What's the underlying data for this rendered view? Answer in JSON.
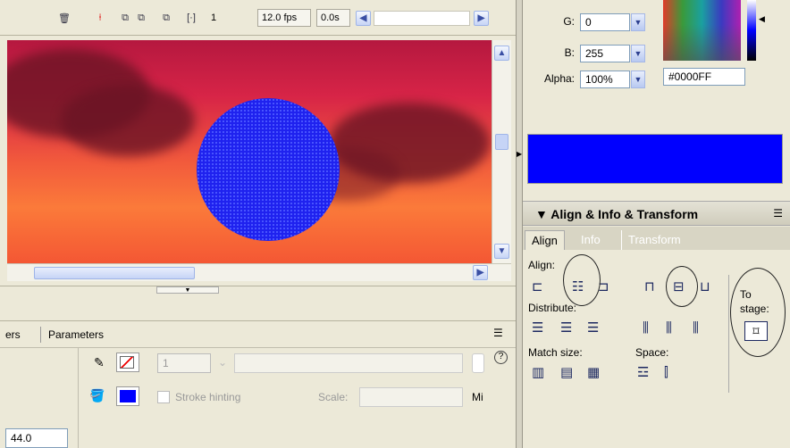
{
  "timeline": {
    "frame": "1",
    "fps": "12.0 fps",
    "time": "0.0s"
  },
  "properties": {
    "tabs_left_partial": "ers",
    "tab_parameters": "Parameters",
    "stroke_size": "1",
    "stroke_hinting": "Stroke hinting",
    "scale_label": "Scale:",
    "miter_label_partial": "Mi",
    "width_value": "44.0"
  },
  "color_mixer": {
    "g_label": "G:",
    "g_value": "0",
    "b_label": "B:",
    "b_value": "255",
    "alpha_label": "Alpha:",
    "alpha_value": "100%",
    "hex_value": "#0000FF",
    "swatch_color": "#0000ff"
  },
  "align_panel": {
    "title": "Align & Info & Transform",
    "tabs": [
      "Align",
      "Info",
      "Transform"
    ],
    "align_label": "Align:",
    "distribute_label": "Distribute:",
    "match_size_label": "Match size:",
    "space_label": "Space:",
    "to_stage_label": "To stage:"
  }
}
